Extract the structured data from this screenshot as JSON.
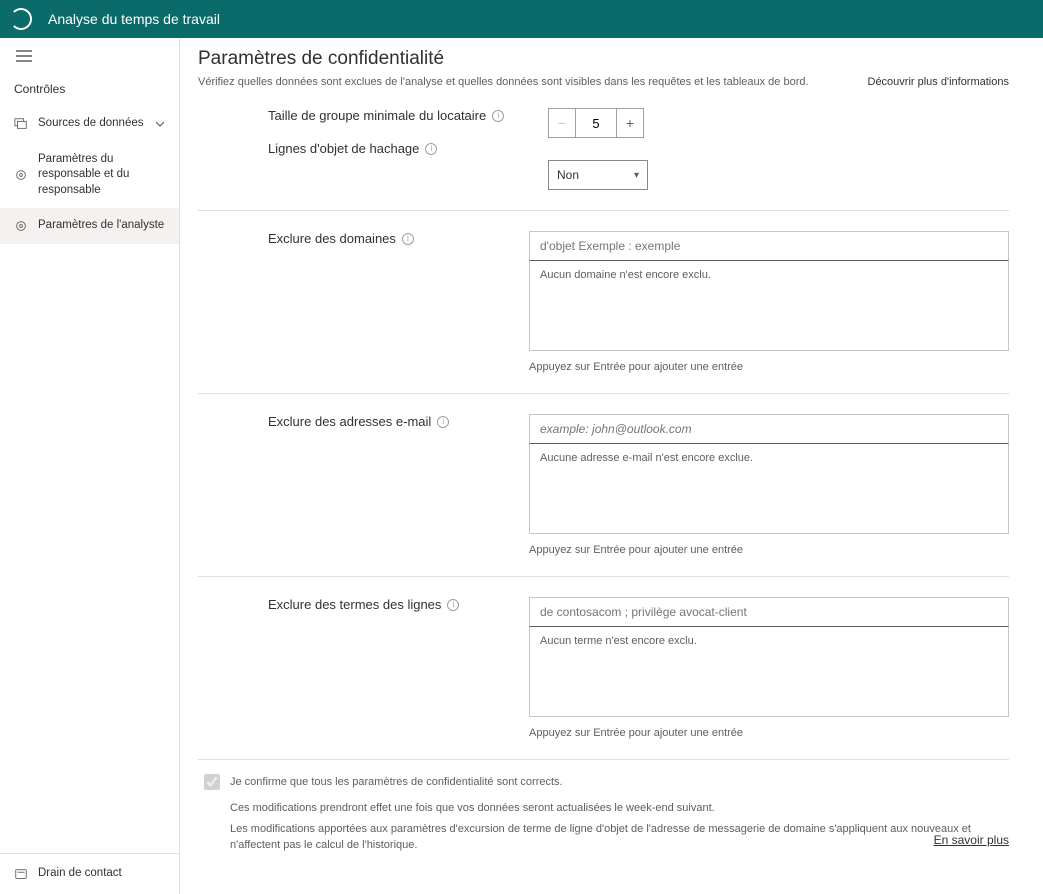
{
  "header": {
    "title": "Analyse du temps de travail"
  },
  "sidebar": {
    "heading": "Contrôles",
    "items": [
      {
        "label": "Sources de données"
      },
      {
        "label": "Paramètres du responsable et du responsable"
      },
      {
        "label": "Paramètres de l'analyste"
      }
    ],
    "footer": {
      "label": "Drain de contact"
    }
  },
  "page": {
    "title": "Paramètres de confidentialité",
    "subtitle": "Vérifiez quelles données sont exclues de l'analyse et quelles données sont visibles dans les requêtes et les tableaux de bord.",
    "more_info": "Découvrir plus d'informations"
  },
  "group_min": {
    "label": "Taille de groupe minimale du locataire",
    "value": "5"
  },
  "hash_lines": {
    "label": "Lignes d'objet de hachage",
    "value": "Non"
  },
  "exclude_domains": {
    "label": "Exclure des domaines",
    "placeholder": "d'objet Exemple : exemple",
    "empty": "Aucun domaine n'est encore exclu.",
    "hint": "Appuyez sur Entrée pour ajouter une entrée"
  },
  "exclude_emails": {
    "label": "Exclure des adresses e-mail",
    "placeholder": "example: john@outlook.com",
    "empty": "Aucune adresse e-mail n'est encore exclue.",
    "hint": "Appuyez sur Entrée pour ajouter une entrée"
  },
  "exclude_terms": {
    "label": "Exclure des termes des lignes",
    "placeholder": "de contosacom ; privilège avocat-client",
    "empty": "Aucun terme n'est encore exclu.",
    "hint": "Appuyez sur Entrée pour ajouter une entrée"
  },
  "confirm": {
    "label": "Je confirme que tous les paramètres de confidentialité sont corrects.",
    "note1": "Ces modifications prendront effet une fois que vos données seront actualisées le week-end suivant.",
    "note2": "Les modifications apportées aux paramètres d'excursion de terme de ligne d'objet de l'adresse de messagerie de domaine s'appliquent aux nouveaux et n'affectent pas le calcul de l'historique.",
    "learn_more": "En savoir plus"
  }
}
